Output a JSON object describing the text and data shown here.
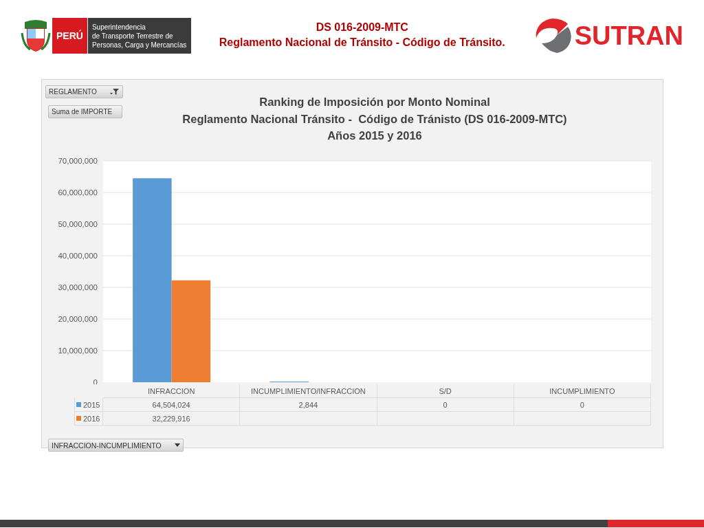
{
  "header": {
    "country": "PERÚ",
    "agency_lines": [
      "Superintendencia",
      "de Transporte Terrestre de",
      "Personas, Carga y Mercancías"
    ],
    "title_lines": [
      "DS 016-2009-MTC",
      "Reglamento Nacional de Tránsito - Código de Tránsito."
    ],
    "brand": "SUTRAN"
  },
  "chart_panel": {
    "filter_buttons": [
      {
        "label": "REGLAMENTO",
        "kind": "filter"
      },
      {
        "label": "Suma de IMPORTE",
        "kind": "plain"
      }
    ],
    "chart_data": {
      "type": "bar",
      "title": "Ranking de Imposición por Monto Nominal\nReglamento Nacional Tránsito -  Código de Tránisto (DS 016-2009-MTC)\nAños 2015 y 2016",
      "categories": [
        "INFRACCION",
        "INCUMPLIMIENTO/INFRACCION",
        "S/D",
        "INCUMPLIMIENTO"
      ],
      "series": [
        {
          "name": "2015",
          "color": "#5b9bd5",
          "values": [
            64504024,
            2844,
            0,
            0
          ]
        },
        {
          "name": "2016",
          "color": "#ed7d31",
          "values": [
            32229916,
            null,
            null,
            null
          ]
        }
      ],
      "ylim": [
        0,
        70000000
      ],
      "grid": true,
      "legend": "bottom-left",
      "yticks": [
        {
          "value": 0,
          "label": "0"
        },
        {
          "value": 10000000,
          "label": "10,000,000"
        },
        {
          "value": 20000000,
          "label": "20,000,000"
        },
        {
          "value": 30000000,
          "label": "30,000,000"
        },
        {
          "value": 40000000,
          "label": "40,000,000"
        },
        {
          "value": 50000000,
          "label": "50,000,000"
        },
        {
          "value": 60000000,
          "label": "60,000,000"
        },
        {
          "value": 70000000,
          "label": "70,000,000"
        }
      ]
    },
    "data_table": [
      [
        "64,504,024",
        "2,844",
        "0",
        "0"
      ],
      [
        "32,229,916"
      ]
    ],
    "field_button": {
      "label": "INFRACCION-INCUMPLIMIENTO"
    }
  }
}
